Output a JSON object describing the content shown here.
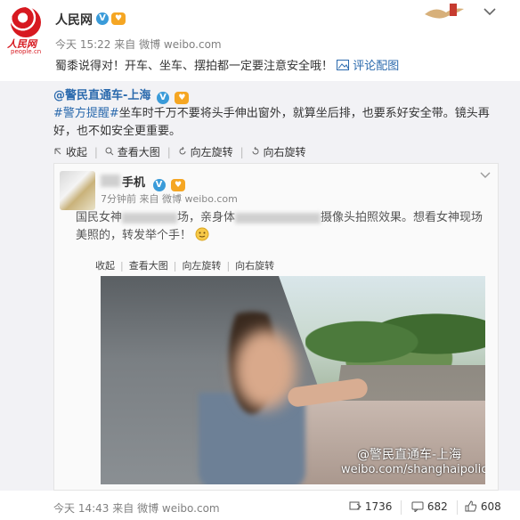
{
  "post": {
    "author": "人民网",
    "avatar_text": "人民网",
    "avatar_domain": "people.cn",
    "time": "今天 15:22",
    "source_prefix": "来自",
    "source": "微博 weibo.com",
    "text": "蜀黍说得对！开车、坐车、摆拍都一定要注意安全哦！",
    "comment_pic_label": "评论配图"
  },
  "repost": {
    "author": "@警民直通车-上海",
    "topic": "#警方提醒#",
    "text": "坐车时千万不要将头手伸出窗外，就算坐后排，也要系好安全带。镜头再好，也不如安全更重要。",
    "actions": [
      "收起",
      "查看大图",
      "向左旋转",
      "向右旋转"
    ]
  },
  "embedded": {
    "author_suffix": "手机",
    "meta": "7分钟前 来自 微博 weibo.com",
    "text_part1": "国民女神",
    "text_part2": "场，亲身体",
    "text_part3": "摄像头拍照效果。想看女神现场",
    "text_line2": "美照的，转发举个手！",
    "actions": [
      "收起",
      "查看大图",
      "向左旋转",
      "向右旋转"
    ],
    "watermark_1": "@警民直通车-上海",
    "watermark_2": "weibo.com/shanghaipolice"
  },
  "footer": {
    "time": "今天 14:43",
    "source_prefix": "来自",
    "source": "微博 weibo.com",
    "reposts": "1736",
    "comments": "682",
    "likes": "608"
  },
  "icons": {
    "verified": "verified-badge-icon",
    "pic": "picture-icon",
    "repost": "repost-icon",
    "comment": "comment-icon",
    "like": "thumbs-up-icon"
  },
  "colors": {
    "link": "#2b6aad",
    "brand_red": "#d71920",
    "repost_bg": "#f2f2f5"
  }
}
